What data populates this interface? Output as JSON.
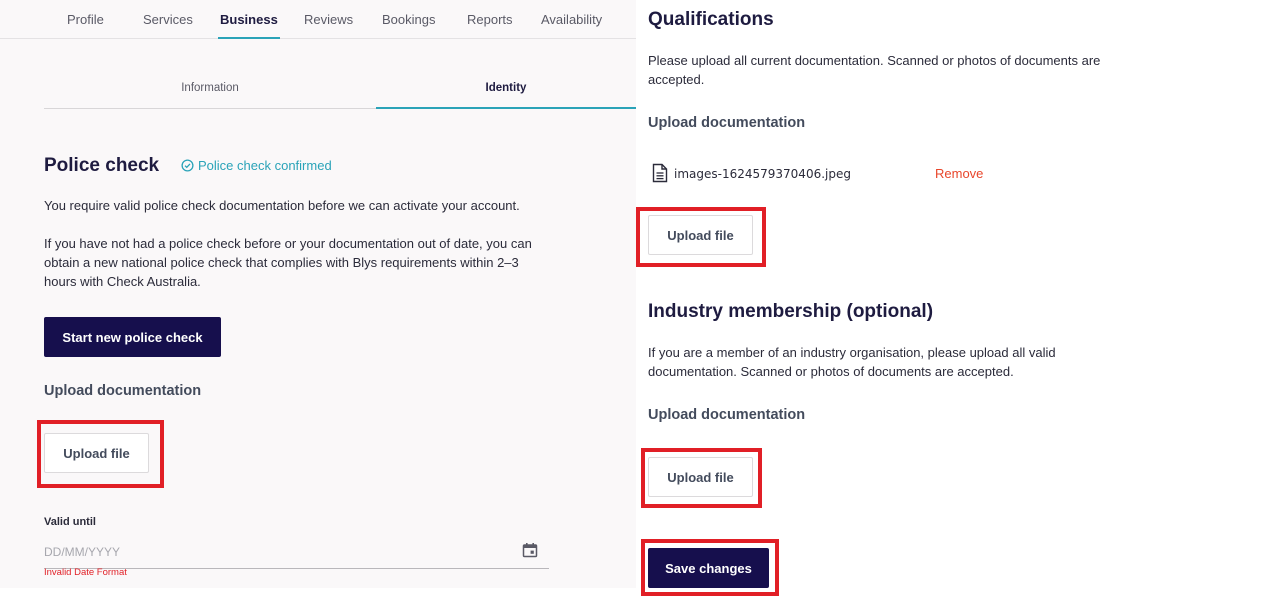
{
  "nav": {
    "tabs": [
      "Profile",
      "Services",
      "Business",
      "Reviews",
      "Bookings",
      "Reports",
      "Availability"
    ],
    "active_tab": "Business"
  },
  "sub_tabs": {
    "items": [
      "Information",
      "Identity"
    ],
    "active": "Identity"
  },
  "police_check": {
    "title": "Police check",
    "status": "Police check confirmed",
    "para1": "You require valid police check documentation before we can activate your account.",
    "para2": "If you have not had a police check before or your documentation out of date, you can obtain a new national police check that complies with Blys requirements within 2–3 hours with Check Australia.",
    "start_button": "Start new police check",
    "upload_heading": "Upload documentation",
    "upload_button": "Upload file",
    "valid_until_label": "Valid until",
    "date_placeholder": "DD/MM/YYYY",
    "date_error": "Invalid Date Format"
  },
  "qualifications": {
    "title": "Qualifications",
    "description": "Please upload all current documentation. Scanned or photos of documents are accepted.",
    "upload_heading": "Upload documentation",
    "file_name": "images-1624579370406.jpeg",
    "remove_label": "Remove",
    "upload_button": "Upload file"
  },
  "industry": {
    "title": "Industry membership (optional)",
    "description": "If you are a member of an industry organisation, please upload all valid documentation. Scanned or photos of documents are accepted.",
    "upload_heading": "Upload documentation",
    "upload_button": "Upload file"
  },
  "save_button": "Save changes",
  "colors": {
    "primary": "#160f4d",
    "accent": "#2aa3b8",
    "highlight": "#e11f26",
    "danger": "#e8462b"
  }
}
